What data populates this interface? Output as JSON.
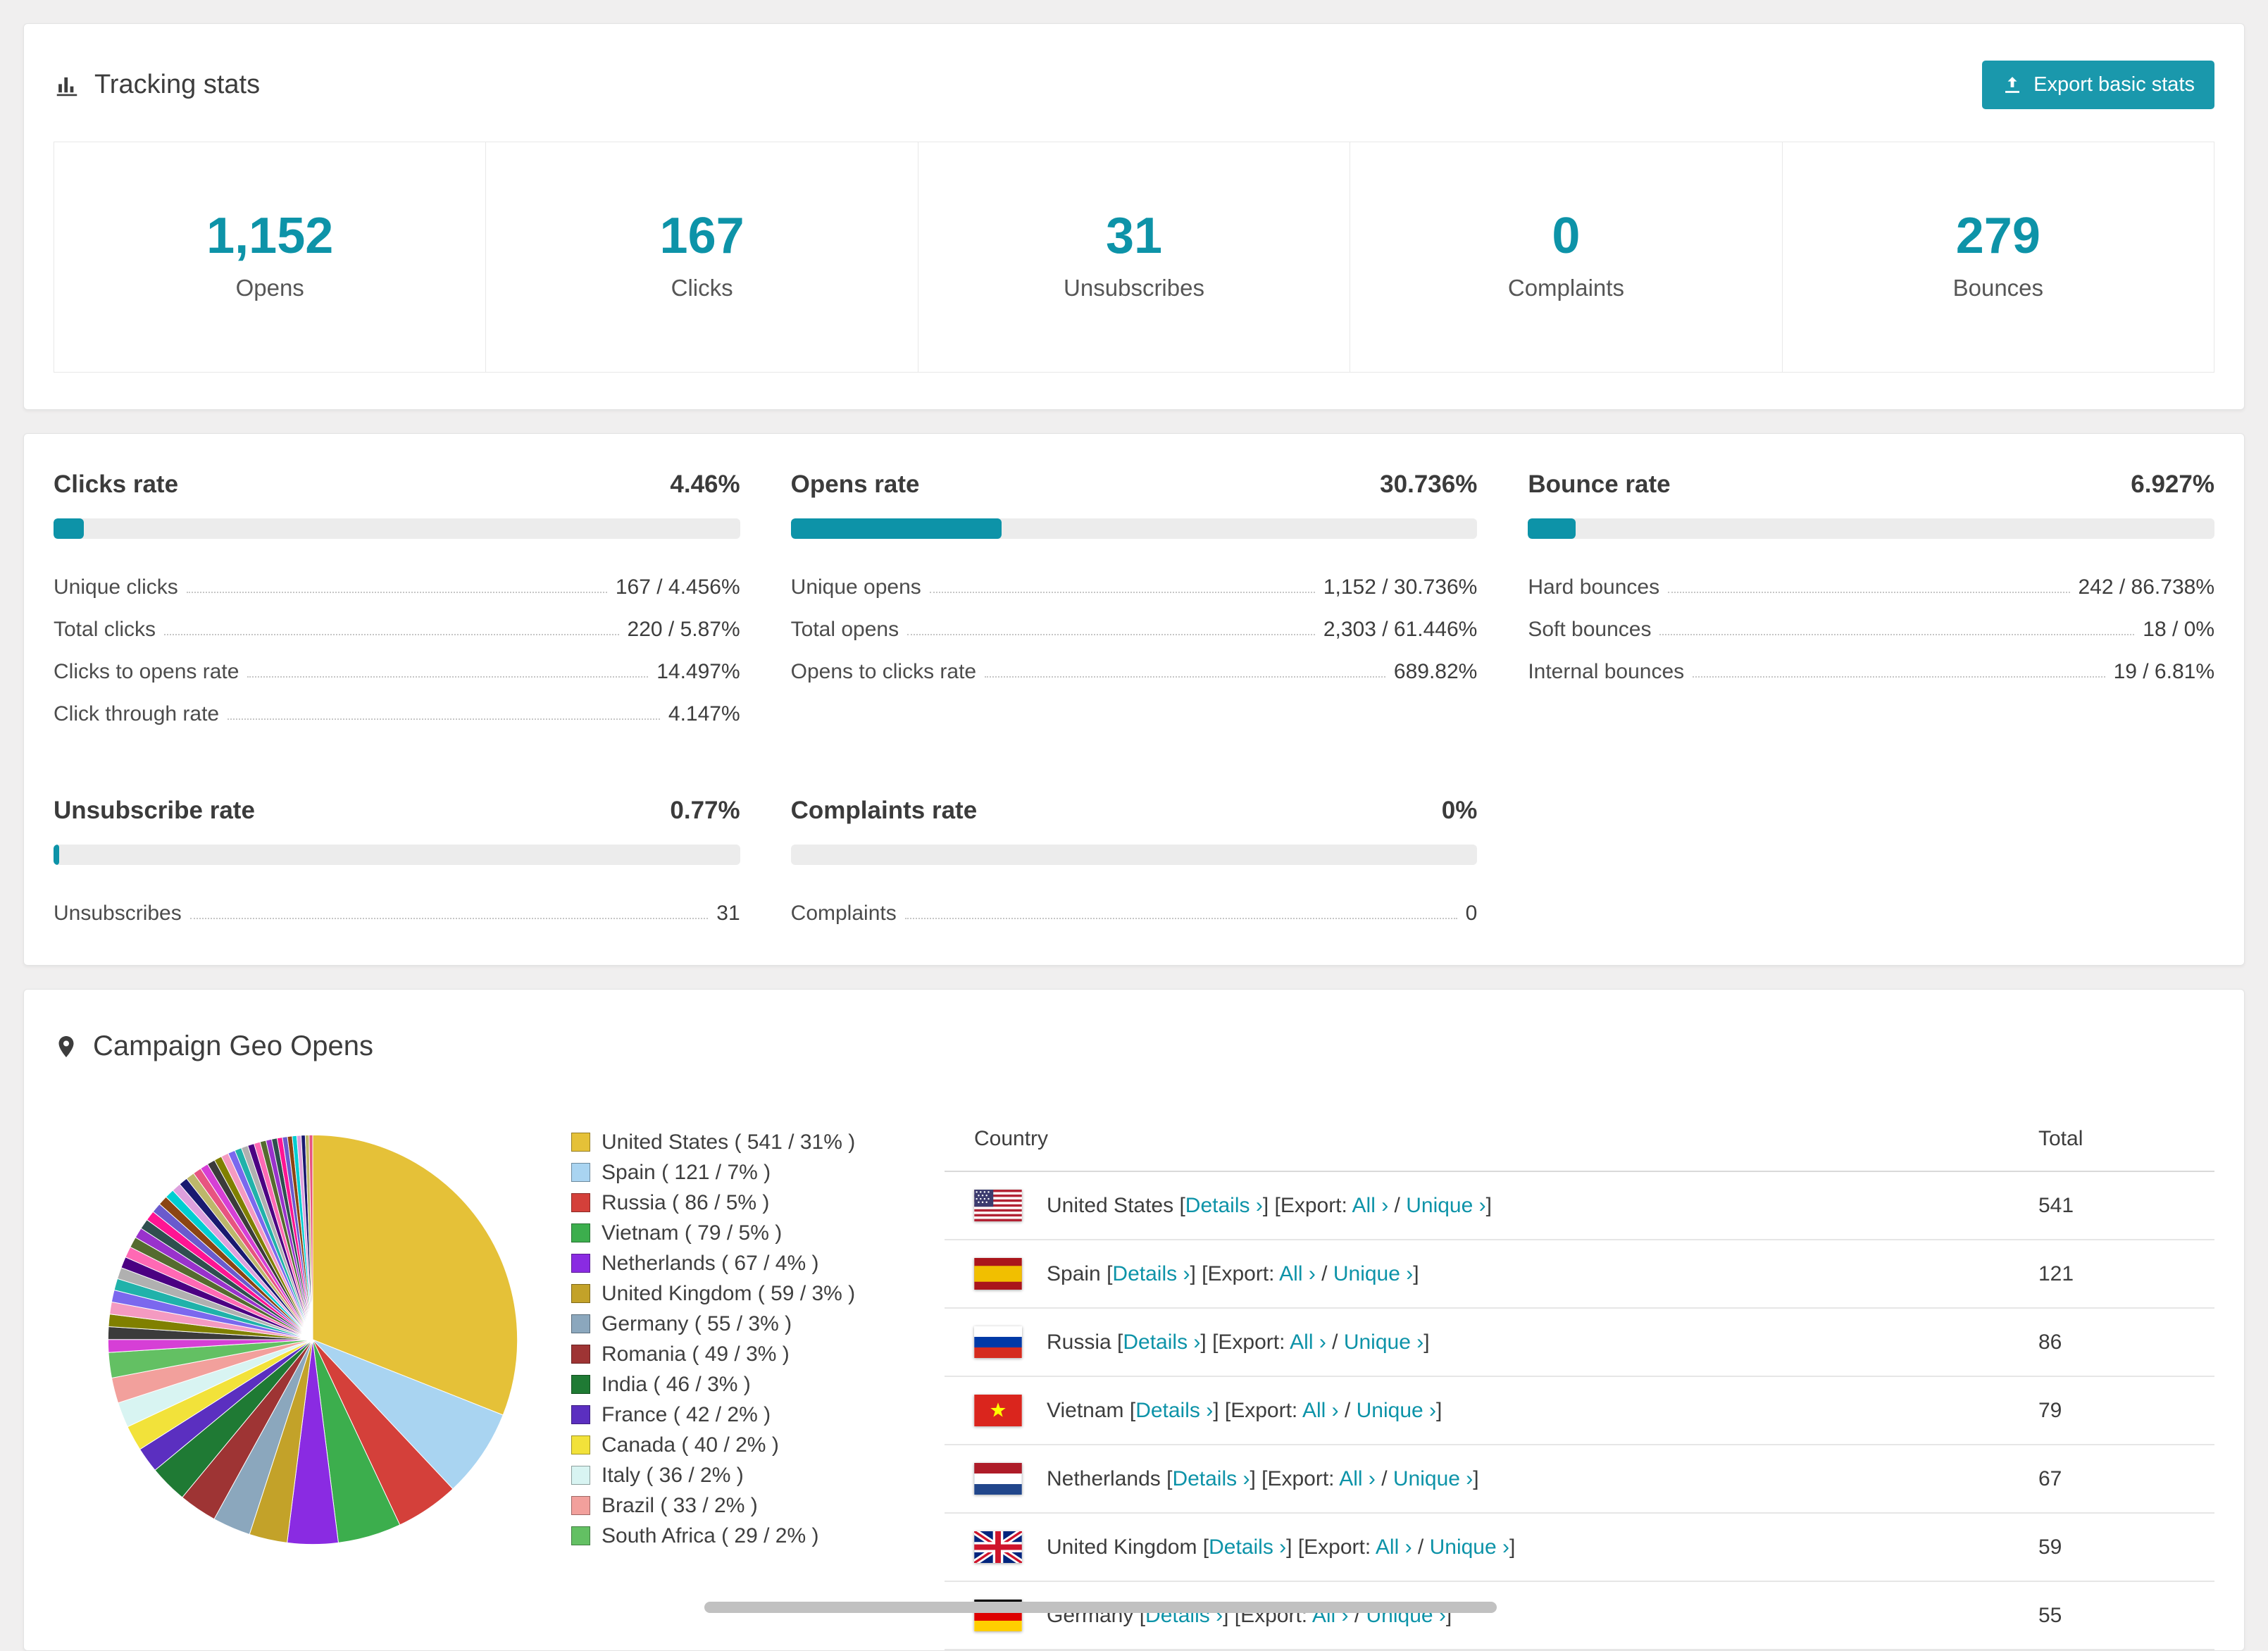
{
  "colors": {
    "accent": "#0d93a8",
    "button": "#1a98ac"
  },
  "tracking": {
    "title": "Tracking stats",
    "export_button": "Export basic stats",
    "stats": [
      {
        "value": "1,152",
        "label": "Opens"
      },
      {
        "value": "167",
        "label": "Clicks"
      },
      {
        "value": "31",
        "label": "Unsubscribes"
      },
      {
        "value": "0",
        "label": "Complaints"
      },
      {
        "value": "279",
        "label": "Bounces"
      }
    ]
  },
  "rates": [
    {
      "title": "Clicks rate",
      "value": "4.46%",
      "percent": 4.46,
      "rows": [
        {
          "label": "Unique clicks",
          "value": "167 / 4.456%"
        },
        {
          "label": "Total clicks",
          "value": "220 / 5.87%"
        },
        {
          "label": "Clicks to opens rate",
          "value": "14.497%"
        },
        {
          "label": "Click through rate",
          "value": "4.147%"
        }
      ]
    },
    {
      "title": "Opens rate",
      "value": "30.736%",
      "percent": 30.736,
      "rows": [
        {
          "label": "Unique opens",
          "value": "1,152 / 30.736%"
        },
        {
          "label": "Total opens",
          "value": "2,303 / 61.446%"
        },
        {
          "label": "Opens to clicks rate",
          "value": "689.82%"
        }
      ]
    },
    {
      "title": "Bounce rate",
      "value": "6.927%",
      "percent": 6.927,
      "rows": [
        {
          "label": "Hard bounces",
          "value": "242 / 86.738%"
        },
        {
          "label": "Soft bounces",
          "value": "18 / 0%"
        },
        {
          "label": "Internal bounces",
          "value": "19 / 6.81%"
        }
      ]
    },
    {
      "title": "Unsubscribe rate",
      "value": "0.77%",
      "percent": 0.77,
      "rows": [
        {
          "label": "Unsubscribes",
          "value": "31"
        }
      ]
    },
    {
      "title": "Complaints rate",
      "value": "0%",
      "percent": 0,
      "rows": [
        {
          "label": "Complaints",
          "value": "0"
        }
      ]
    }
  ],
  "geo": {
    "title": "Campaign Geo Opens",
    "table": {
      "country_header": "Country",
      "total_header": "Total",
      "details_label": "Details",
      "export_label": "Export:",
      "all_label": "All",
      "unique_label": "Unique",
      "chevron": "›",
      "bracket_open": "[",
      "bracket_close": "]",
      "rows": [
        {
          "country": "United States",
          "flag": "us",
          "total": "541"
        },
        {
          "country": "Spain",
          "flag": "es",
          "total": "121"
        },
        {
          "country": "Russia",
          "flag": "ru",
          "total": "86"
        },
        {
          "country": "Vietnam",
          "flag": "vn",
          "total": "79"
        },
        {
          "country": "Netherlands",
          "flag": "nl",
          "total": "67"
        },
        {
          "country": "United Kingdom",
          "flag": "gb",
          "total": "59"
        },
        {
          "country": "Germany",
          "flag": "de",
          "total": "55"
        }
      ]
    }
  },
  "chart_data": {
    "type": "pie",
    "title": "Campaign Geo Opens",
    "legend_position": "right",
    "categories": [
      "United States",
      "Spain",
      "Russia",
      "Vietnam",
      "Netherlands",
      "United Kingdom",
      "Germany",
      "Romania",
      "India",
      "France",
      "Canada",
      "Italy",
      "Brazil",
      "South Africa"
    ],
    "values": [
      541,
      121,
      86,
      79,
      67,
      59,
      55,
      49,
      46,
      42,
      40,
      36,
      33,
      29
    ],
    "percents": [
      31,
      7,
      5,
      5,
      4,
      3,
      3,
      3,
      3,
      2,
      2,
      2,
      2,
      2
    ],
    "colors": [
      "#e5c138",
      "#a9d4f1",
      "#d4403a",
      "#3cae4d",
      "#8a2be2",
      "#c3a229",
      "#8ba7bd",
      "#9e3434",
      "#1f7a34",
      "#5b2fc0",
      "#f2e23a",
      "#d8f4f2",
      "#f2a09c",
      "#63c063"
    ],
    "others_percent": 26,
    "others_palette": [
      "#d63fd6",
      "#3b3b3b",
      "#808000",
      "#f49ac1",
      "#7b68ee",
      "#20b2aa",
      "#b0b0b0",
      "#4b0082",
      "#ff69b4",
      "#556b2f",
      "#9932cc",
      "#2f4f4f",
      "#ff1493",
      "#6a5acd",
      "#8b4513",
      "#00ced1",
      "#dda0dd",
      "#191970",
      "#bdb76b",
      "#e75480"
    ]
  }
}
